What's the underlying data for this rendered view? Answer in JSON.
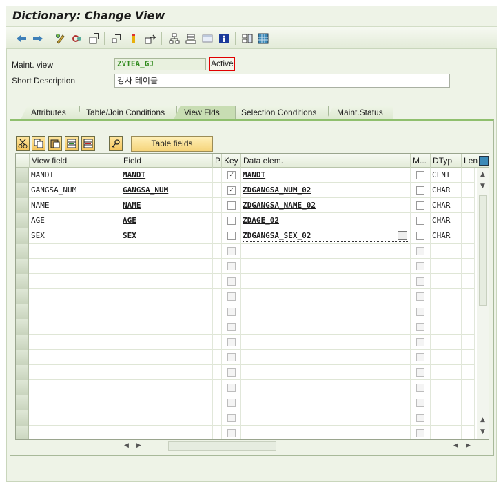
{
  "window": {
    "title": "Dictionary: Change View"
  },
  "toolbar": {
    "icons": [
      "back-arrow-icon",
      "forward-arrow-icon",
      "display-change-icon",
      "activate-icon",
      "where-used-icon",
      "object-list-icon",
      "navigate-icon",
      "other-object-icon",
      "hierarchy-icon",
      "stack-icon",
      "screen-icon",
      "info-icon",
      "table-view-icon",
      "grid-icon"
    ]
  },
  "header": {
    "maint_view_label": "Maint. view",
    "maint_view_value": "ZVTEA_GJ",
    "status": "Active",
    "short_desc_label": "Short Description",
    "short_desc_value": "강사 테이블"
  },
  "tabs": [
    {
      "label": "Attributes",
      "active": false
    },
    {
      "label": "Table/Join Conditions",
      "active": false
    },
    {
      "label": "View Flds",
      "active": true
    },
    {
      "label": "Selection Conditions",
      "active": false
    },
    {
      "label": "Maint.Status",
      "active": false
    }
  ],
  "table_controls": {
    "table_fields_label": "Table fields"
  },
  "columns": [
    "View field",
    "Field",
    "P",
    "Key",
    "Data elem.",
    "M...",
    "DTyp",
    "Len"
  ],
  "rows": [
    {
      "view_field": "MANDT",
      "field": "MANDT",
      "key": true,
      "data_elem": "MANDT",
      "dtyp": "CLNT"
    },
    {
      "view_field": "GANGSA_NUM",
      "field": "GANGSA_NUM",
      "key": true,
      "data_elem": "ZDGANGSA_NUM_02",
      "dtyp": "CHAR"
    },
    {
      "view_field": "NAME",
      "field": "NAME",
      "key": false,
      "data_elem": "ZDGANGSA_NAME_02",
      "dtyp": "CHAR"
    },
    {
      "view_field": "AGE",
      "field": "AGE",
      "key": false,
      "data_elem": "ZDAGE_02",
      "dtyp": "CHAR"
    },
    {
      "view_field": "SEX",
      "field": "SEX",
      "key": false,
      "data_elem": "ZDGANGSA_SEX_02",
      "dtyp": "CHAR"
    }
  ],
  "empty_rows": 13,
  "colors": {
    "accent_green": "#2f8a1c",
    "highlight_red": "#e00000",
    "button_yellow": "#f5d47a"
  }
}
